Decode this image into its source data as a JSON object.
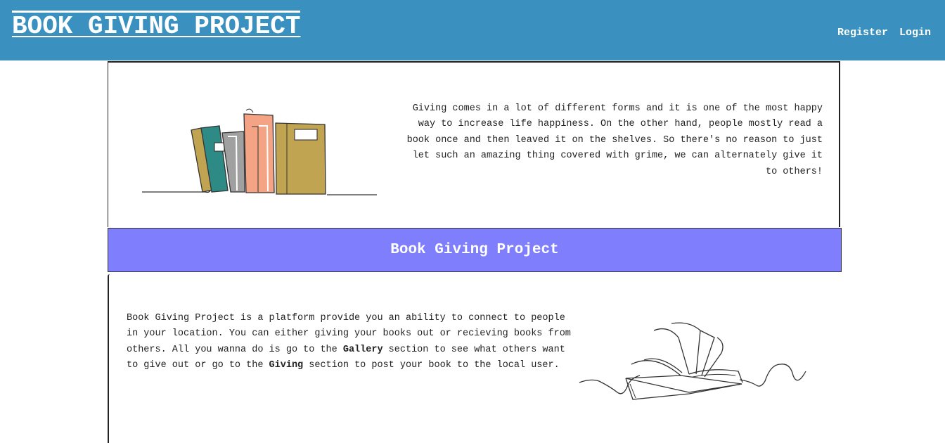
{
  "header": {
    "title": "BOOK GIVING PROJECT",
    "nav": {
      "register": "Register",
      "login": "Login"
    }
  },
  "intro": {
    "text": "Giving comes in a lot of different forms and it is one of the most happy way to increase life happiness. On the other hand, people mostly read a book once and then leaved it on the shelves. So there's no reason to just let such an amazing thing covered with grime, we can alternately give it to others!"
  },
  "banner": {
    "title": "Book Giving Project"
  },
  "about": {
    "part1": "Book Giving Project is a platform provide you an ability to connect to people in your location. You can either giving your books out or recieving books from others. All you wanna do is go to the ",
    "gallery": "Gallery",
    "part2": " section to see what others want to give out or go to the ",
    "giving": "Giving",
    "part3": " section to post your book to the local user."
  },
  "colors": {
    "header_bg": "#3a91bf",
    "banner_bg": "#7f7ffe",
    "book_gold": "#c1a452",
    "book_teal": "#2e8a85",
    "book_gray": "#a0a0a0",
    "book_peach": "#f4a485"
  },
  "icons": [
    "books-illustration",
    "open-book-illustration"
  ]
}
